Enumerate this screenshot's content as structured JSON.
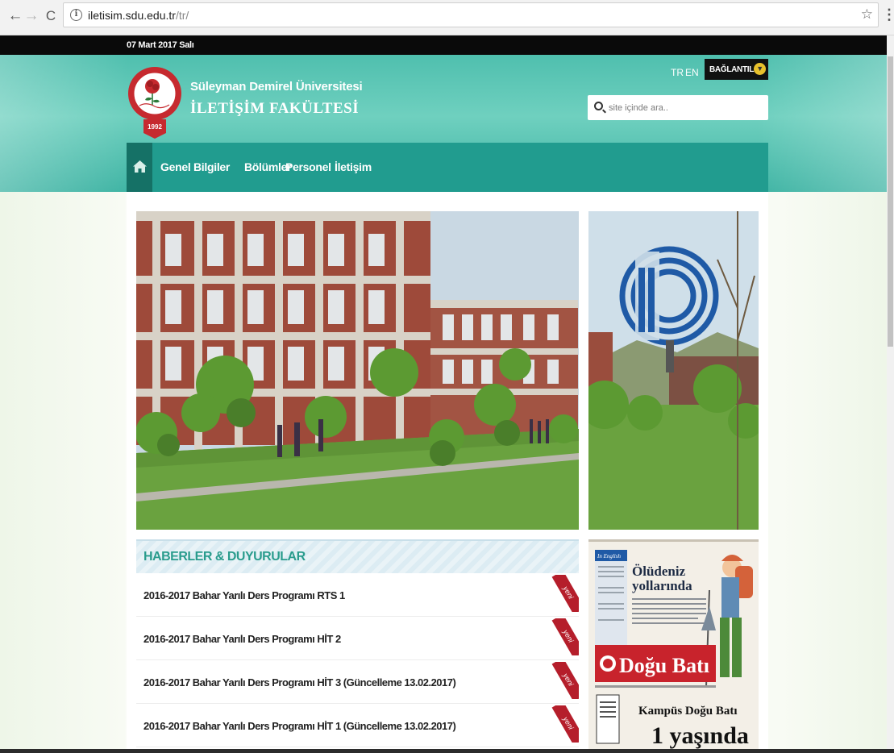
{
  "browser": {
    "url_host": "iletisim.sdu.edu.tr",
    "url_path": "/tr/",
    "back_glyph": "←",
    "forward_glyph": "→",
    "reload_glyph": "C",
    "info_glyph": "i",
    "star_glyph": "☆",
    "menu_glyph": "⋮"
  },
  "topbar": {
    "date": "07 Mart 2017 Salı"
  },
  "header": {
    "university_name": "Süleyman Demirel Üniversitesi",
    "faculty_name": "İLETİŞİM FAKÜLTESİ",
    "seal_year": "1992",
    "lang_tr": "TR",
    "lang_en": "EN",
    "links_label": "BAĞLANTILAR"
  },
  "search": {
    "placeholder": "site içinde ara.."
  },
  "nav": {
    "home_icon": "home-icon",
    "items": [
      "Genel Bilgiler",
      "Bölümler",
      "Personel",
      "İletişim"
    ]
  },
  "news": {
    "heading": "HABERLER & DUYURULAR",
    "badge_label": "yeni",
    "items": [
      "2016-2017 Bahar Yarılı Ders Programı RTS 1",
      "2016-2017 Bahar Yarılı Ders Programı HİT 2",
      "2016-2017 Bahar Yarılı Ders Programı HİT 3 (Güncelleme 13.02.2017)",
      "2016-2017 Bahar Yarılı Ders Programı HİT 1 (Güncelleme 13.02.2017)"
    ]
  },
  "promo": {
    "tag": "In English",
    "headline_1": "Ölüdeniz",
    "headline_2": "yollarında",
    "paper_name": "Doğu Batı",
    "kampus_title": "Kampüs Doğu Batı",
    "kampus_sub": "1 yaşında"
  },
  "colors": {
    "teal": "#219c8f",
    "teal_dark": "#157166",
    "news_heading": "#2a9c8d",
    "ribbon_red": "#b51e2b"
  }
}
